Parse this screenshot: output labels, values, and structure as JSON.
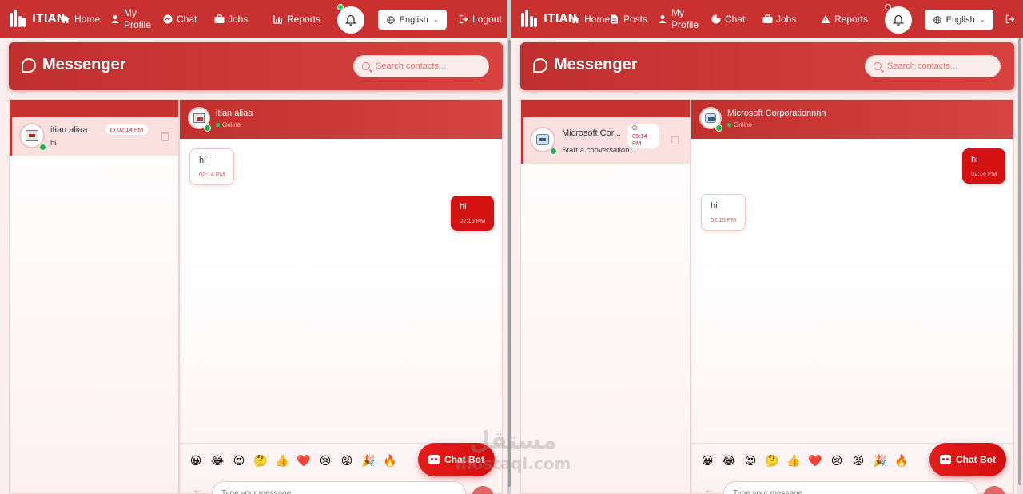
{
  "left": {
    "navbar": {
      "brand": "ITIAN",
      "items": [
        {
          "label": "Home",
          "icon": "home-icon"
        },
        {
          "label": "My Profile",
          "icon": "user-icon"
        },
        {
          "label": "Chat",
          "icon": "messenger-icon"
        },
        {
          "label": "Jobs",
          "icon": "briefcase-icon"
        },
        {
          "label": "Reports",
          "icon": "chart-icon"
        }
      ],
      "language": "English",
      "logout": "Logout"
    },
    "messenger": {
      "title": "Messenger",
      "search_placeholder": "Search contacts..."
    },
    "contact": {
      "name": "itian aliaa",
      "preview": "hi",
      "time": "02:14 PM"
    },
    "chat": {
      "name": "itian aliaa",
      "status": "Online",
      "messages": [
        {
          "direction": "in",
          "text": "hi",
          "time": "02:14 PM"
        },
        {
          "direction": "out",
          "text": "hi",
          "time": "02:15 PM"
        }
      ],
      "input_placeholder": "Type your message..."
    }
  },
  "right": {
    "navbar": {
      "brand": "ITIAN",
      "items": [
        {
          "label": "Home",
          "icon": "home-icon"
        },
        {
          "label": "Posts",
          "icon": "document-icon"
        },
        {
          "label": "My Profile",
          "icon": "user-icon"
        },
        {
          "label": "Chat",
          "icon": "messenger-icon"
        },
        {
          "label": "Jobs",
          "icon": "briefcase-icon"
        },
        {
          "label": "Reports",
          "icon": "warning-icon"
        }
      ],
      "language": "English"
    },
    "messenger": {
      "title": "Messenger",
      "search_placeholder": "Search contacts..."
    },
    "contact": {
      "name": "Microsoft Cor...",
      "preview": "Start a conversation...",
      "time": "05:14 PM"
    },
    "chat": {
      "name": "Microsoft Corporationnnn",
      "status": "Online",
      "messages": [
        {
          "direction": "out",
          "text": "hi",
          "time": "02:14 PM"
        },
        {
          "direction": "in",
          "text": "hi",
          "time": "02:15 PM"
        }
      ],
      "input_placeholder": "Type your message..."
    }
  },
  "emojis": [
    "😀",
    "😂",
    "😍",
    "🤔",
    "👍",
    "❤️",
    "😢",
    "😡",
    "🎉",
    "🔥"
  ],
  "chatbot_label": "Chat Bot",
  "watermark": {
    "arabic": "مستقل",
    "latin": "mostaql.com"
  },
  "colors": {
    "primary": "#c8312f",
    "bubble_out": "#d41212",
    "online": "#22b24c"
  }
}
